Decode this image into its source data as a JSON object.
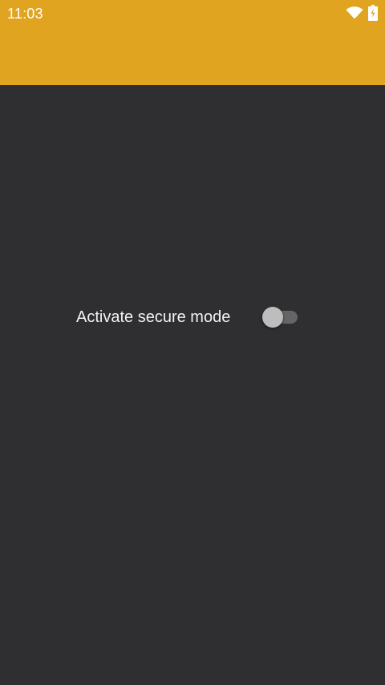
{
  "status_bar": {
    "time": "11:03",
    "icons": [
      "wifi-icon",
      "battery-charging-icon"
    ]
  },
  "app_bar": {
    "color": "#e0a420"
  },
  "main": {
    "background": "#2f2e30",
    "secure_mode": {
      "label": "Activate secure mode",
      "enabled": false
    }
  }
}
